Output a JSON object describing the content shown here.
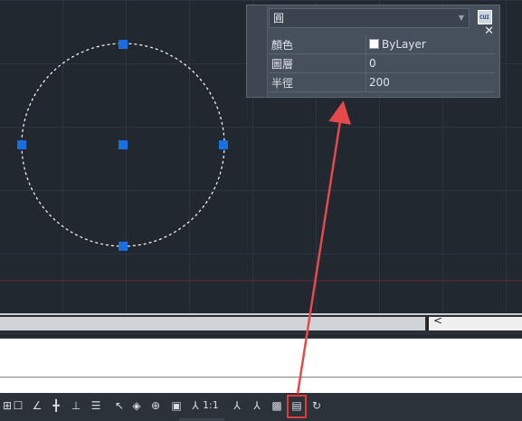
{
  "quick_properties": {
    "object_type": "圓",
    "rows": [
      {
        "label": "顏色",
        "value": "ByLayer"
      },
      {
        "label": "圖層",
        "value": "0"
      },
      {
        "label": "半徑",
        "value": "200"
      }
    ],
    "settings_icon_text": "CUI"
  },
  "statusbar": {
    "annotation_scale": "1:1"
  },
  "colors": {
    "canvas_bg": "#212830",
    "grip": "#1a6fe0",
    "annotation_arrow": "#e44a4a",
    "highlight": "#e03a3a"
  }
}
